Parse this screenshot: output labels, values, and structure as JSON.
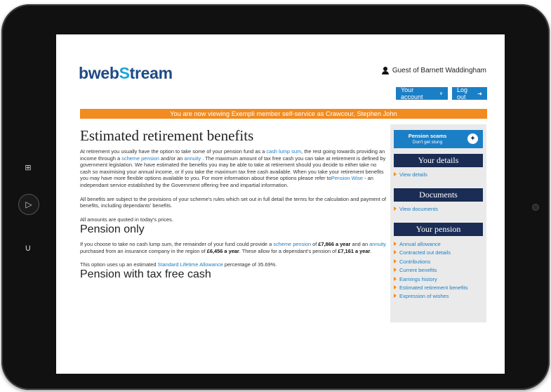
{
  "tablet": {
    "left_buttons": [
      "grid-icon",
      "play-icon",
      "back-icon"
    ]
  },
  "header": {
    "logo_prefix": "bweb",
    "logo_s": "S",
    "logo_suffix": "tream",
    "guest_text": "Guest of Barnett Waddingham",
    "account_button": "Your account",
    "logout_button": "Log out"
  },
  "banner": "You are now viewing Exempli member self-service as Crawcour, Stephen John",
  "main": {
    "title": "Estimated retirement benefits",
    "intro": {
      "t1": "At retirement you usually have the option to take some of your pension fund as a ",
      "l1": "cash lump sum",
      "t2": ", the rest going towards providing an income through a ",
      "l2": "scheme pension",
      "t3": " and/or an ",
      "l3": "annuity",
      "t4": " . The maximum amount of tax free cash you can take at retirement is defined by government legislation. We have estimated the benefits you may be able to take at retirement should you decide to either take no cash so maximising your annual income, or if you take the maximum tax free cash available. When you take your retirement benefits you may have more flexible options available to you. For more information about these options please refer to",
      "l4": "Pension Wise",
      "t5": " - an independant service established by the Government offering free and impartial information."
    },
    "para2": "All benefits are subject to the provisions of your scheme's rules which set out in full detail the terms for the calculation and payment of benefits, including dependants' benefits.",
    "para3": "All amounts are quoted in today's prices.",
    "section1": {
      "title": "Pension only",
      "t1": "If you choose to take no cash lump sum, the remainder of your fund could provide a ",
      "l1": "scheme pension",
      "t2": " of ",
      "b1": "£7,866 a year",
      "t3": " and an ",
      "l2": "annuity",
      "t4": " purchased from an insurance company in the region of ",
      "b2": "£6,456 a year",
      "t5": ". These allow for a dependant's pension of ",
      "b3": "£7,161 a year",
      "t6": ".",
      "p2_t1": "This option uses up an estimated ",
      "p2_l1": "Standard Lifetime Allowance",
      "p2_t2": " percentage of 35.69%."
    },
    "section2": {
      "title": "Pension with tax free cash"
    }
  },
  "sidebar": {
    "scam_title": "Pension scams",
    "scam_sub": "Don't get stung",
    "your_details": "Your details",
    "view_details": "View details",
    "documents": "Documents",
    "view_documents": "View documents",
    "your_pension": "Your pension",
    "pension_links": [
      "Annual allowance",
      "Contracted out details",
      "Contributions",
      "Current benefits",
      "Earnings history",
      "Estimated retirement benefits",
      "Expression of wishes"
    ]
  },
  "colors": {
    "brand_blue": "#1b7fc6",
    "navy": "#1b2d55",
    "orange": "#f28b20"
  }
}
